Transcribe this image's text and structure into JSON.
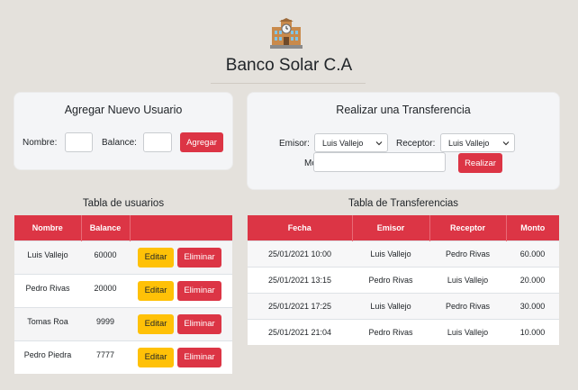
{
  "header": {
    "title": "Banco Solar C.A",
    "logo_icon": "bank-building-icon"
  },
  "new_user": {
    "title": "Agregar Nuevo Usuario",
    "name_label": "Nombre:",
    "name_value": "",
    "balance_label": "Balance:",
    "balance_value": "",
    "submit_label": "Agregar"
  },
  "transfer": {
    "title": "Realizar una Transferencia",
    "sender_label": "Emisor:",
    "sender_value": "Luis Vallejo",
    "receiver_label": "Receptor:",
    "receiver_value": "Luis Vallejo",
    "amount_label": "Monto:",
    "amount_value": "",
    "submit_label": "Realizar"
  },
  "users_table": {
    "title": "Tabla de usuarios",
    "columns": [
      "Nombre",
      "Balance",
      ""
    ],
    "edit_label": "Editar",
    "delete_label": "Eliminar",
    "rows": [
      {
        "nombre": "Luis Vallejo",
        "balance": "60000"
      },
      {
        "nombre": "Pedro Rivas",
        "balance": "20000"
      },
      {
        "nombre": "Tomas Roa",
        "balance": "9999"
      },
      {
        "nombre": "Pedro Piedra",
        "balance": "7777"
      }
    ]
  },
  "transfers_table": {
    "title": "Tabla de Transferencias",
    "columns": [
      "Fecha",
      "Emisor",
      "Receptor",
      "Monto"
    ],
    "rows": [
      {
        "fecha": "25/01/2021 10:00",
        "emisor": "Luis Vallejo",
        "receptor": "Pedro Rivas",
        "monto": "60.000"
      },
      {
        "fecha": "25/01/2021 13:15",
        "emisor": "Pedro Rivas",
        "receptor": "Luis Vallejo",
        "monto": "20.000"
      },
      {
        "fecha": "25/01/2021 17:25",
        "emisor": "Luis Vallejo",
        "receptor": "Pedro Rivas",
        "monto": "30.000"
      },
      {
        "fecha": "25/01/2021 21:04",
        "emisor": "Pedro Rivas",
        "receptor": "Luis Vallejo",
        "monto": "10.000"
      }
    ]
  },
  "colors": {
    "primary": "#dc3545",
    "warning": "#ffc107",
    "background": "#e4e1dc"
  }
}
